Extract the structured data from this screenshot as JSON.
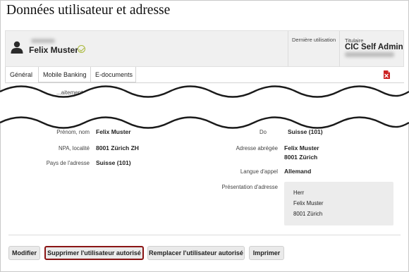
{
  "page": {
    "title": "Données utilisateur et adresse"
  },
  "header": {
    "user_name": "Felix Muster",
    "last_use_label": "Dernière utilisation",
    "holder_label": "Titulaire",
    "holder_name": "CIC Self Admin",
    "icons": [
      "user-avatar-icon",
      "verified-check-icon"
    ]
  },
  "tabs": [
    {
      "label": "Général",
      "active": true
    },
    {
      "label": "Mobile Banking",
      "active": false
    },
    {
      "label": "E-documents",
      "active": false
    }
  ],
  "tab_icons": [
    "pdf-export-icon"
  ],
  "partial_section": {
    "text": "...aitements"
  },
  "left_fields": [
    {
      "label": "Prénom, nom",
      "value": "Felix Muster"
    },
    {
      "label": "NPA, localité",
      "value": "8001 Zürich ZH"
    },
    {
      "label": "Pays de l'adresse",
      "value": "Suisse (101)"
    }
  ],
  "right_fields": {
    "domicile_label_partial": "Do",
    "domicile_value": "Suisse (101)",
    "short_address_label": "Adresse abrégée",
    "short_address_lines": [
      "Felix Muster",
      "8001 Zürich"
    ],
    "language_label": "Langue d'appel",
    "language_value": "Allemand",
    "address_presentation_label": "Présentation d'adresse",
    "address_presentation_lines": [
      "Herr",
      "Felix Muster",
      "8001 Zürich"
    ]
  },
  "buttons": {
    "modify": "Modifier",
    "delete_authorized": "Supprimer l'utilisateur autorisé",
    "replace_authorized": "Remplacer l'utilisateur autorisé",
    "print": "Imprimer"
  },
  "colors": {
    "highlight_border": "#8a1414",
    "verified_icon": "#a9b83a",
    "pdf_icon": "#cc2222",
    "header_bg": "#f0f0f0"
  }
}
